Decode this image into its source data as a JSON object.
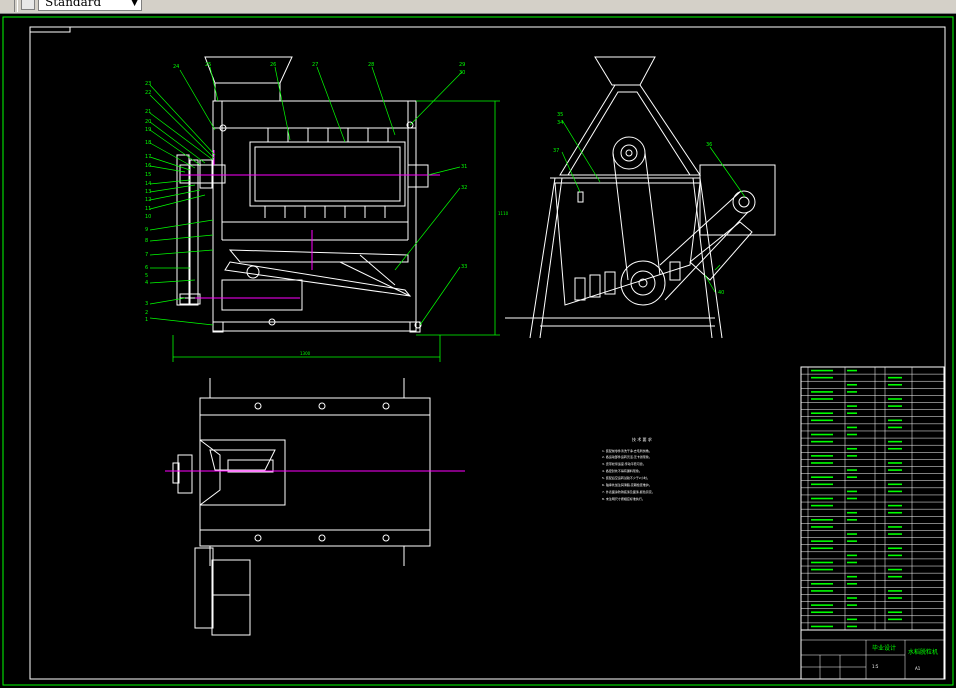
{
  "toolbar": {
    "text_style_value": "Standard",
    "text_style_icon": "text-style-icon",
    "dropdown_icon": "chevron-down-icon"
  },
  "colors": {
    "background": "#000000",
    "frame": "#00ff00",
    "lines": "#ffffff",
    "centerline": "#ff00ff",
    "leaders": "#00ff00",
    "labels": "#00ff00",
    "dimensions": "#00ff00"
  },
  "front_view": {
    "callouts_left": [
      "23",
      "22",
      "21",
      "20",
      "19",
      "18",
      "17",
      "16",
      "15",
      "14",
      "13",
      "12",
      "11",
      "10",
      "9",
      "8",
      "7",
      "6",
      "5",
      "4",
      "3",
      "2",
      "1"
    ],
    "callouts_top": [
      "24",
      "25",
      "26",
      "27",
      "28",
      "29",
      "30"
    ],
    "callouts_right": [
      "31",
      "32",
      "33"
    ],
    "width_dim": "1300",
    "height_dim": "1110"
  },
  "side_view": {
    "callouts": [
      "35",
      "34",
      "37",
      "36",
      "40"
    ]
  },
  "notes": {
    "title": "技 术 要 求",
    "lines": [
      "1. 装配前零件清洗干净,去毛刺倒角。",
      "2. 各运动部件运转灵活,无卡滞现象。",
      "3. 皮带松紧适度,传动平稳可靠。",
      "4. 各密封处不得有漏料现象。",
      "5. 装配后空运转试验不少于2小时。",
      "6. 轴承处加注润滑脂,定期检查维护。",
      "7. 外表面涂防锈底漆及面漆,颜色另定。",
      "8. 未注明尺寸按相应标准执行。"
    ]
  },
  "title_block": {
    "project": "毕业设计",
    "drawing_name": "水稻脱粒机",
    "scale": "1:5",
    "sheet": "A1"
  }
}
